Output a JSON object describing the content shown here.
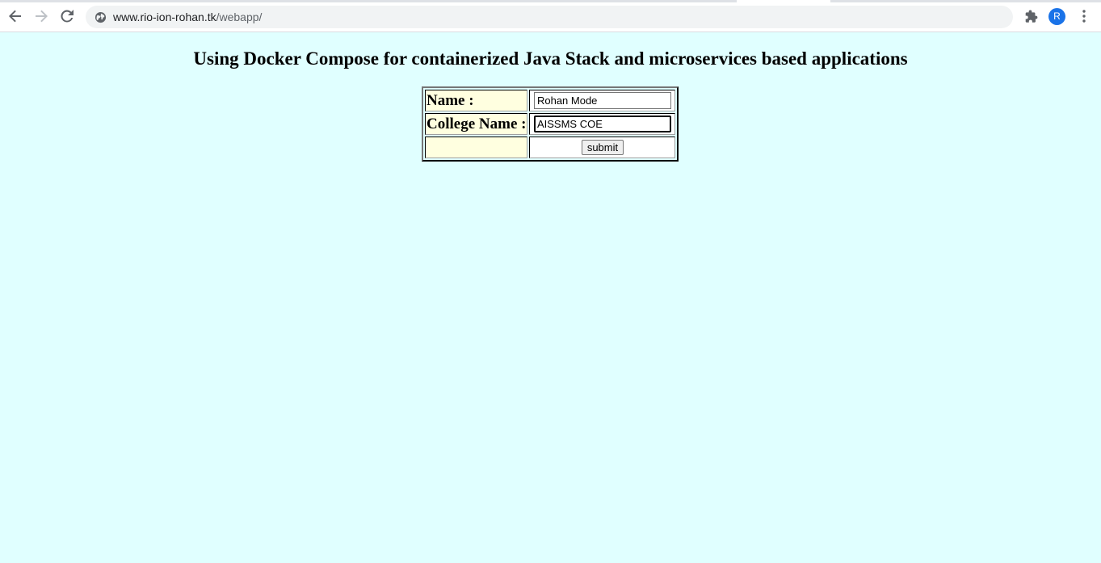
{
  "browser": {
    "url_host": "www.rio-ion-rohan.tk",
    "url_path": "/webapp/",
    "avatar_letter": "R",
    "accent_color": "#1a73e8"
  },
  "page": {
    "background_color": "#e0ffff",
    "label_cell_color": "#ffffe0",
    "title": "Using Docker Compose for containerized Java Stack and microservices based applications",
    "form": {
      "name_label": "Name :",
      "name_value": "Rohan Mode",
      "college_label": "College Name :",
      "college_value": "AISSMS COE",
      "submit_label": "submit"
    }
  }
}
